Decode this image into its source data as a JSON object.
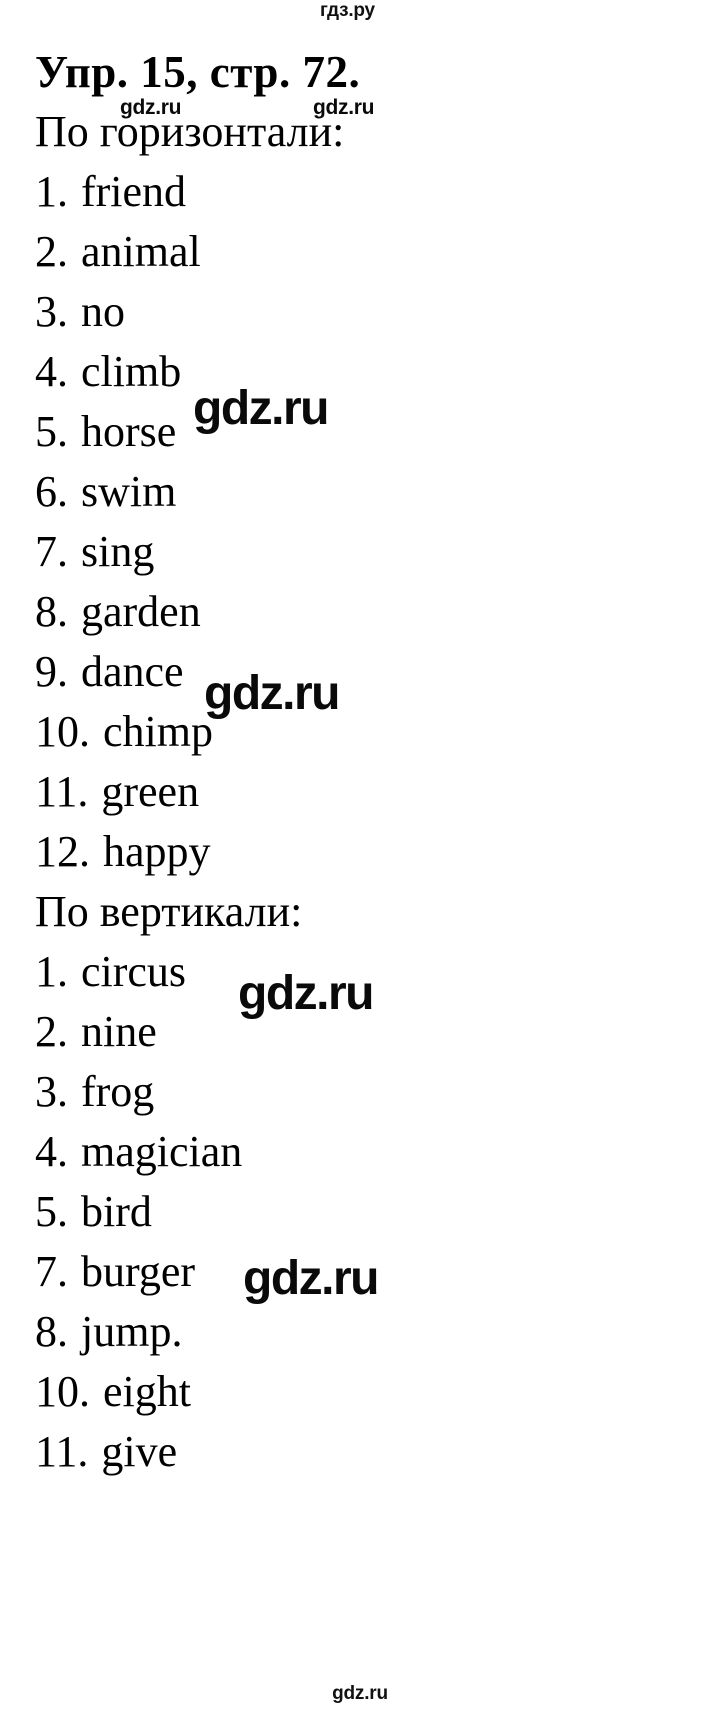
{
  "site": {
    "logo_top": "гдз.ру",
    "logo_footer": "gdz.ru"
  },
  "exercise": {
    "title": "Упр. 15, стр. 72."
  },
  "across": {
    "heading": "По горизонтали:",
    "items": [
      {
        "index": "1.",
        "word": "friend"
      },
      {
        "index": "2.",
        "word": "animal"
      },
      {
        "index": "3.",
        "word": "no"
      },
      {
        "index": "4.",
        "word": "climb"
      },
      {
        "index": "5.",
        "word": "horse"
      },
      {
        "index": "6.",
        "word": "swim"
      },
      {
        "index": "7.",
        "word": "sing"
      },
      {
        "index": "8.",
        "word": "garden"
      },
      {
        "index": "9.",
        "word": "dance"
      },
      {
        "index": "10.",
        "word": "chimp"
      },
      {
        "index": "11.",
        "word": "green"
      },
      {
        "index": "12.",
        "word": "happy"
      }
    ]
  },
  "down": {
    "heading": "По вертикали:",
    "items": [
      {
        "index": "1.",
        "word": "circus"
      },
      {
        "index": "2.",
        "word": "nine"
      },
      {
        "index": "3.",
        "word": "frog"
      },
      {
        "index": "4.",
        "word": "magician"
      },
      {
        "index": "5.",
        "word": "bird"
      },
      {
        "index": "7.",
        "word": "burger"
      },
      {
        "index": "8.",
        "word": "jump."
      },
      {
        "index": "10.",
        "word": "eight"
      },
      {
        "index": "11.",
        "word": "give"
      }
    ]
  },
  "watermarks": [
    {
      "text": "gdz.ru"
    },
    {
      "text": "gdz.ru"
    },
    {
      "text": "gdz.ru"
    },
    {
      "text": "gdz.ru"
    },
    {
      "text": "gdz.ru"
    },
    {
      "text": "gdz.ru"
    }
  ],
  "colors": {
    "text": "#000000",
    "background": "#ffffff",
    "watermark": "#0a0a0a"
  }
}
